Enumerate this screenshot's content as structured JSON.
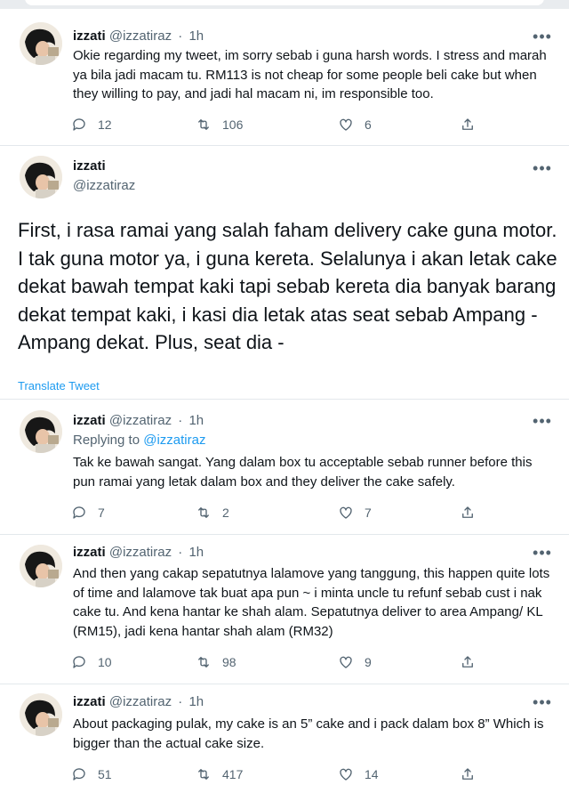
{
  "tweets": [
    {
      "name": "izzati",
      "handle": "@izzatiraz",
      "time": "1h",
      "text": "Okie regarding my tweet, im sorry sebab i guna harsh words. I stress and marah ya bila jadi macam tu. RM113 is not cheap for some people beli cake but when they willing to pay, and jadi hal macam ni, im responsible too.",
      "replies": "12",
      "retweets": "106",
      "likes": "6"
    },
    {
      "name": "izzati",
      "handle": "@izzatiraz",
      "time": "1h",
      "reply_prefix": "Replying to",
      "reply_to": "@izzatiraz",
      "text": "Tak ke bawah sangat. Yang dalam box tu acceptable sebab runner before this pun ramai yang letak dalam box and they deliver the cake safely.",
      "replies": "7",
      "retweets": "2",
      "likes": "7"
    },
    {
      "name": "izzati",
      "handle": "@izzatiraz",
      "time": "1h",
      "text": "And then yang cakap sepatutnya lalamove yang tanggung, this happen quite lots of time and lalamove tak buat apa pun ~ i minta uncle tu refunf sebab cust i nak cake tu. And kena hantar ke shah alam. Sepatutnya deliver to area Ampang/ KL (RM15), jadi kena hantar shah alam (RM32)",
      "replies": "10",
      "retweets": "98",
      "likes": "9"
    },
    {
      "name": "izzati",
      "handle": "@izzatiraz",
      "time": "1h",
      "text": "About packaging pulak, my cake is an 5” cake and i pack dalam box 8” Which is bigger than the actual cake size.",
      "replies": "51",
      "retweets": "417",
      "likes": "14"
    }
  ],
  "main_tweet": {
    "name": "izzati",
    "handle": "@izzatiraz",
    "text": "First, i rasa ramai yang salah faham delivery cake guna motor. I tak guna motor ya, i guna kereta. Selalunya i akan letak cake dekat bawah tempat kaki tapi sebab kereta dia banyak barang dekat tempat kaki, i kasi dia letak atas seat sebab Ampang - Ampang dekat. Plus, seat dia -",
    "translate_label": "Translate Tweet"
  },
  "more_glyph": "•••",
  "separator": "·",
  "colors": {
    "text": "#0f1419",
    "secondary": "#536471",
    "accent": "#1d9bf0",
    "divider": "#e3e8ec"
  },
  "icons": [
    "reply-icon",
    "retweet-icon",
    "like-icon",
    "share-icon",
    "more-icon",
    "avatar"
  ]
}
